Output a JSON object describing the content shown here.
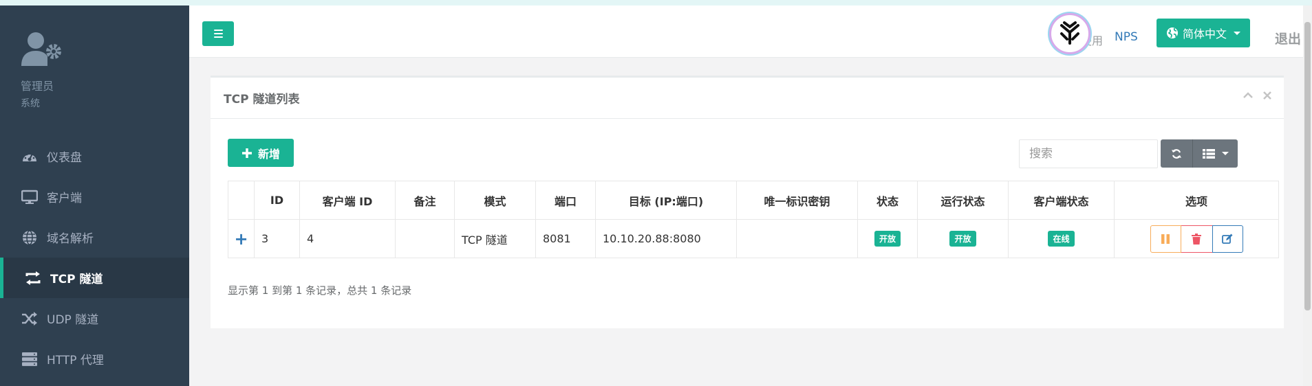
{
  "profile": {
    "name": "管理员",
    "role": "系统"
  },
  "sidebar": {
    "items": [
      {
        "label": "仪表盘",
        "icon": "dashboard-icon"
      },
      {
        "label": "客户端",
        "icon": "desktop-icon"
      },
      {
        "label": "域名解析",
        "icon": "globe-icon"
      },
      {
        "label": "TCP 隧道",
        "icon": "exchange-icon",
        "active": true
      },
      {
        "label": "UDP 隧道",
        "icon": "random-icon"
      },
      {
        "label": "HTTP 代理",
        "icon": "server-icon"
      }
    ]
  },
  "header": {
    "welcome": "欢迎使用",
    "brand": "NPS",
    "language": "简体中文",
    "logout": "退出"
  },
  "panel": {
    "title": "TCP 隧道列表",
    "add_label": "新增",
    "search_placeholder": "搜索",
    "columns": [
      "",
      "ID",
      "客户端 ID",
      "备注",
      "模式",
      "端口",
      "目标 (IP:端口)",
      "唯一标识密钥",
      "状态",
      "运行状态",
      "客户端状态",
      "选项"
    ],
    "rows": [
      {
        "expand": "+",
        "id": "3",
        "client_id": "4",
        "remark": "",
        "mode": "TCP 隧道",
        "port": "8081",
        "target": "10.10.20.88:8080",
        "key": "",
        "status": "开放",
        "run_status": "开放",
        "client_status": "在线"
      }
    ],
    "record_info": "显示第 1 到第 1 条记录，总共 1 条记录"
  },
  "colors": {
    "primary": "#1ab394",
    "sidebar_bg": "#2f4050",
    "warning": "#f8ac59",
    "danger": "#ed5565",
    "info": "#337ab7"
  }
}
